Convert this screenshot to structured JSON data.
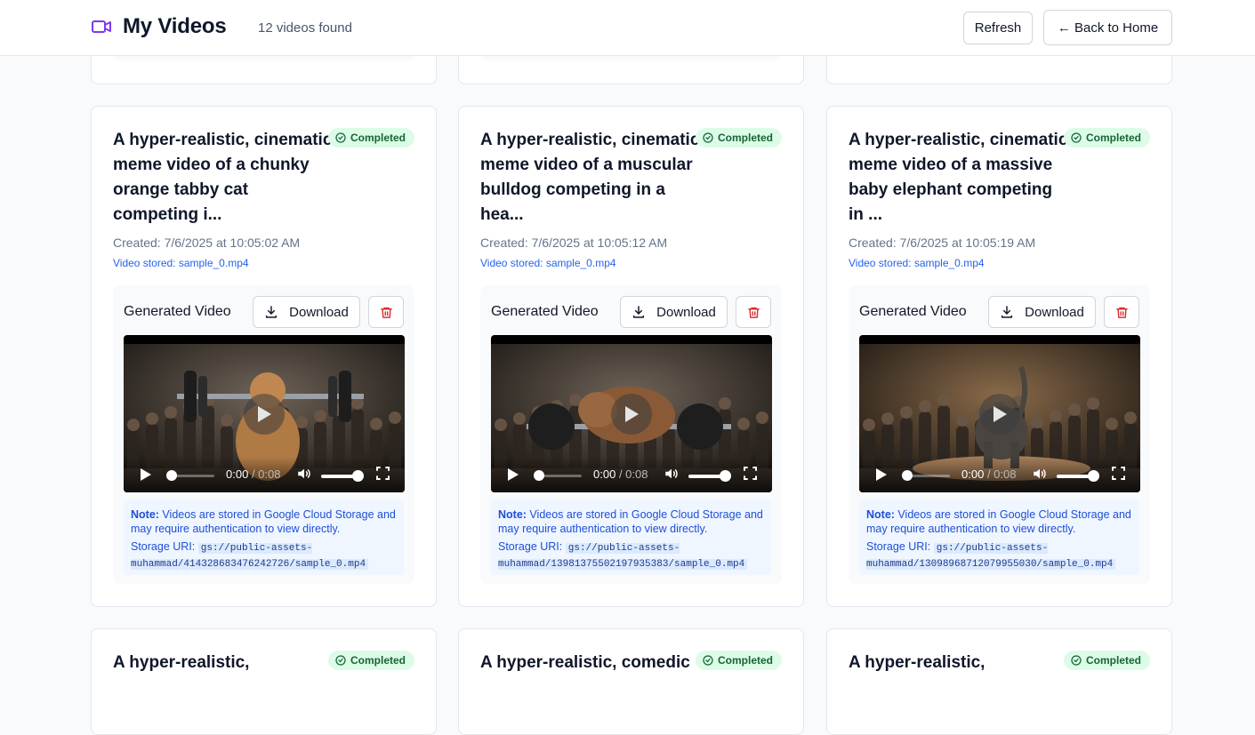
{
  "header": {
    "title": "My Videos",
    "count": "12 videos found",
    "refresh_label": "Refresh",
    "back_label": "← Back to Home",
    "accent": "#7c3aed"
  },
  "cards": [
    {
      "title": "A hyper-realistic, cinematic meme video of a chunky orange tabby cat competing i...",
      "status": "Completed",
      "created": "Created: 7/6/2025 at 10:05:02 AM",
      "stored": "Video stored: sample_0.mp4",
      "panel_label": "Generated Video",
      "download_label": "Download",
      "time_current": "0:00",
      "time_duration": "/ 0:08",
      "note_label": "Note:",
      "note_text": " Videos are stored in Google Cloud Storage and may require authentication to view directly.",
      "uri_label": "Storage URI:",
      "uri": "gs://public-assets-muhammad/414328683476242726/sample_0.mp4",
      "thumb": "cat"
    },
    {
      "title": "A hyper-realistic, cinematic meme video of a muscular bulldog competing in a hea...",
      "status": "Completed",
      "created": "Created: 7/6/2025 at 10:05:12 AM",
      "stored": "Video stored: sample_0.mp4",
      "panel_label": "Generated Video",
      "download_label": "Download",
      "time_current": "0:00",
      "time_duration": "/ 0:08",
      "note_label": "Note:",
      "note_text": " Videos are stored in Google Cloud Storage and may require authentication to view directly.",
      "uri_label": "Storage URI:",
      "uri": "gs://public-assets-muhammad/13981375502197935383/sample_0.mp4",
      "thumb": "bulldog"
    },
    {
      "title": "A hyper-realistic, cinematic meme video of a massive baby elephant competing in ...",
      "status": "Completed",
      "created": "Created: 7/6/2025 at 10:05:19 AM",
      "stored": "Video stored: sample_0.mp4",
      "panel_label": "Generated Video",
      "download_label": "Download",
      "time_current": "0:00",
      "time_duration": "/ 0:08",
      "note_label": "Note:",
      "note_text": " Videos are stored in Google Cloud Storage and may require authentication to view directly.",
      "uri_label": "Storage URI:",
      "uri": "gs://public-assets-muhammad/13098968712079955030/sample_0.mp4",
      "thumb": "elephant"
    }
  ],
  "bottom_cards": [
    {
      "title": "A hyper-realistic,",
      "status": "Completed"
    },
    {
      "title": "A hyper-realistic, comedic",
      "status": "Completed"
    },
    {
      "title": "A hyper-realistic,",
      "status": "Completed"
    }
  ]
}
